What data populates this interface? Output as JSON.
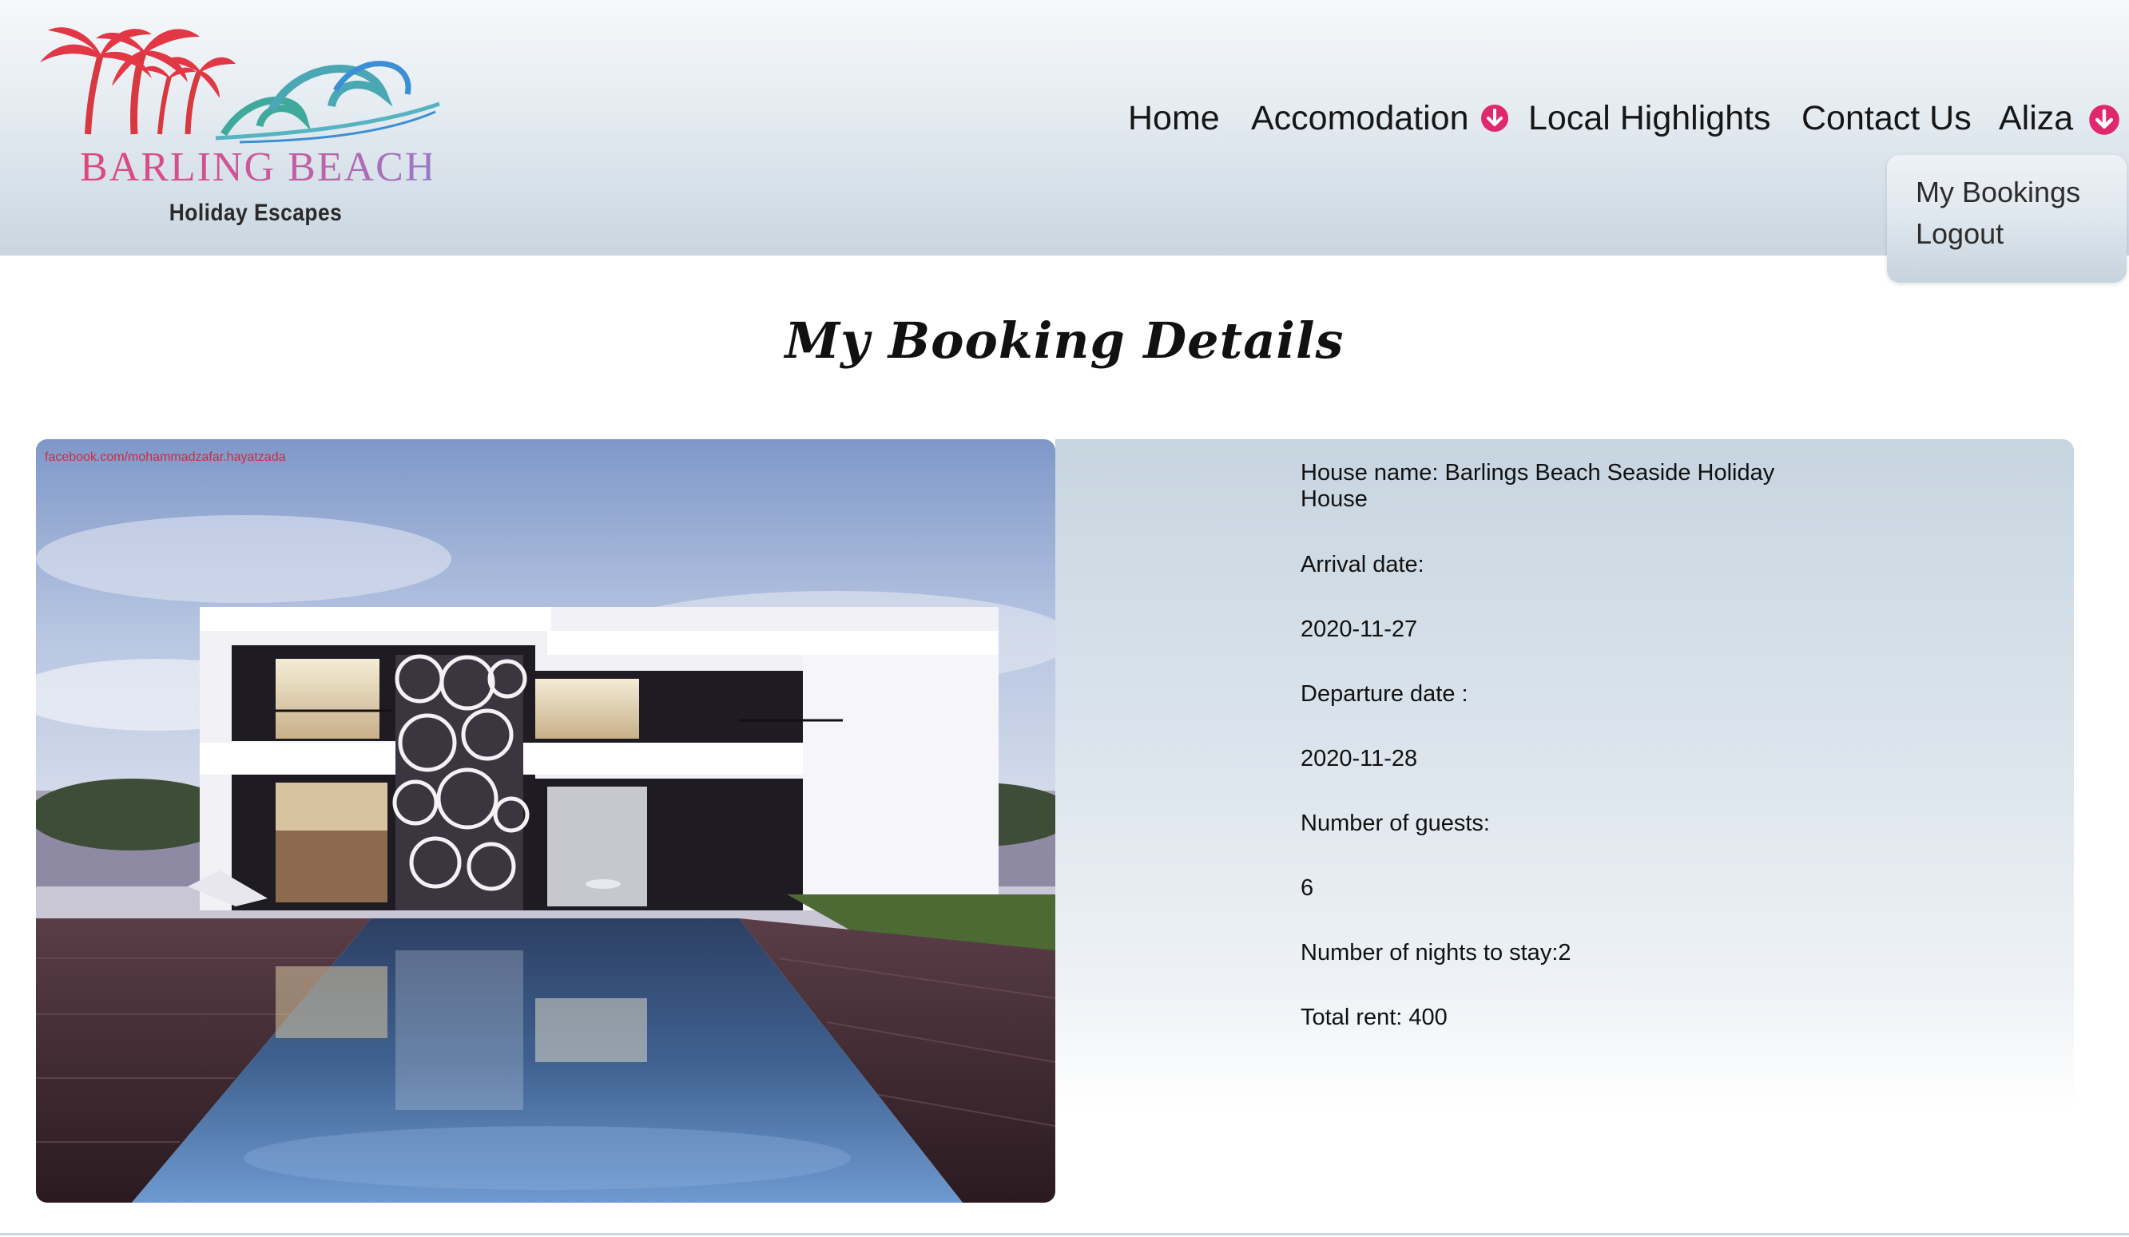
{
  "logo": {
    "title": "BARLING BEACH",
    "subtitle": "Holiday Escapes"
  },
  "nav": {
    "home": "Home",
    "accommodation": "Accomodation",
    "local_highlights": "Local Highlights",
    "contact": "Contact Us",
    "user": "Aliza"
  },
  "user_menu": {
    "my_bookings": "My Bookings",
    "logout": "Logout"
  },
  "page": {
    "title": "My Booking Details"
  },
  "photo": {
    "credit": "facebook.com/mohammadzafar.hayatzada"
  },
  "booking": {
    "house_name": "House name: Barlings Beach Seaside Holiday House",
    "arrival_label": "Arrival date:",
    "arrival_value": "2020-11-27",
    "departure_label": "Departure date :",
    "departure_value": "2020-11-28",
    "guests_label": "Number of guests:",
    "guests_value": "6",
    "nights": "Number of nights to stay:2",
    "total_rent": "Total rent: 400"
  },
  "colors": {
    "accent": "#e0286e",
    "logo_pink": "#e0457b",
    "wave_teal": "#3fa99b",
    "wave_blue": "#3b8fd4"
  }
}
